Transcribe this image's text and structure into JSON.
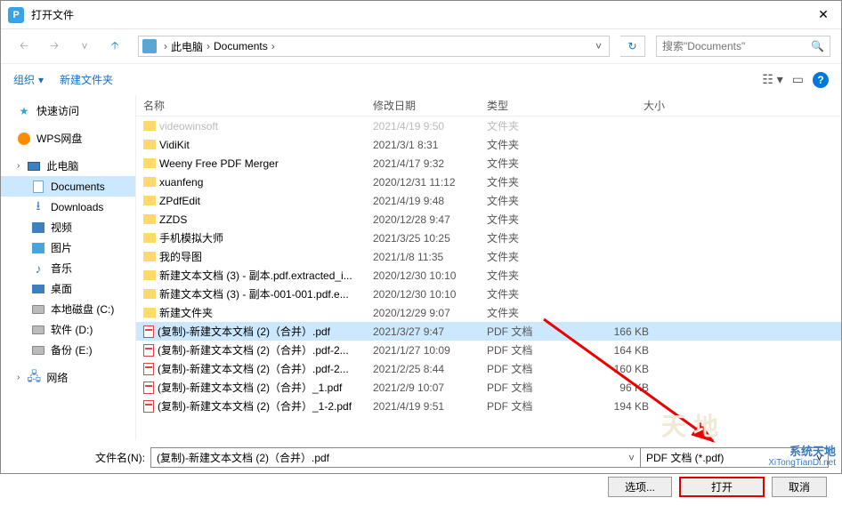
{
  "window": {
    "title": "打开文件"
  },
  "breadcrumb": {
    "root": "此电脑",
    "folder": "Documents"
  },
  "search": {
    "placeholder": "搜索\"Documents\""
  },
  "toolbar": {
    "organize": "组织",
    "newfolder": "新建文件夹"
  },
  "columns": {
    "name": "名称",
    "date": "修改日期",
    "type": "类型",
    "size": "大小"
  },
  "sidebar": [
    {
      "label": "快速访问",
      "icon": "star"
    },
    {
      "label": "WPS网盘",
      "icon": "wps"
    },
    {
      "label": "此电脑",
      "icon": "pc",
      "chev": true
    },
    {
      "label": "Documents",
      "icon": "doc",
      "indent": true,
      "selected": true
    },
    {
      "label": "Downloads",
      "icon": "down",
      "indent": true
    },
    {
      "label": "视频",
      "icon": "video",
      "indent": true
    },
    {
      "label": "图片",
      "icon": "img",
      "indent": true
    },
    {
      "label": "音乐",
      "icon": "music",
      "indent": true
    },
    {
      "label": "桌面",
      "icon": "desk",
      "indent": true
    },
    {
      "label": "本地磁盘 (C:)",
      "icon": "drive",
      "indent": true
    },
    {
      "label": "软件 (D:)",
      "icon": "drive",
      "indent": true
    },
    {
      "label": "备份 (E:)",
      "icon": "drive",
      "indent": true
    },
    {
      "label": "网络",
      "icon": "net",
      "chev": true
    }
  ],
  "files": [
    {
      "name": "videowinsoft",
      "date": "2021/4/19 9:50",
      "type": "文件夹",
      "icon": "folder",
      "dim": true
    },
    {
      "name": "VidiKit",
      "date": "2021/3/1 8:31",
      "type": "文件夹",
      "icon": "folder"
    },
    {
      "name": "Weeny Free PDF Merger",
      "date": "2021/4/17 9:32",
      "type": "文件夹",
      "icon": "folder"
    },
    {
      "name": "xuanfeng",
      "date": "2020/12/31 11:12",
      "type": "文件夹",
      "icon": "folder"
    },
    {
      "name": "ZPdfEdit",
      "date": "2021/4/19 9:48",
      "type": "文件夹",
      "icon": "folder"
    },
    {
      "name": "ZZDS",
      "date": "2020/12/28 9:47",
      "type": "文件夹",
      "icon": "folder"
    },
    {
      "name": "手机模拟大师",
      "date": "2021/3/25 10:25",
      "type": "文件夹",
      "icon": "folder"
    },
    {
      "name": "我的导图",
      "date": "2021/1/8 11:35",
      "type": "文件夹",
      "icon": "folder"
    },
    {
      "name": "新建文本文档 (3) - 副本.pdf.extracted_i...",
      "date": "2020/12/30 10:10",
      "type": "文件夹",
      "icon": "folder"
    },
    {
      "name": "新建文本文档 (3) - 副本-001-001.pdf.e...",
      "date": "2020/12/30 10:10",
      "type": "文件夹",
      "icon": "folder"
    },
    {
      "name": "新建文件夹",
      "date": "2020/12/29 9:07",
      "type": "文件夹",
      "icon": "folder"
    },
    {
      "name": "(复制)-新建文本文档 (2)（合并）.pdf",
      "date": "2021/3/27 9:47",
      "type": "PDF 文档",
      "size": "166 KB",
      "icon": "pdf",
      "selected": true
    },
    {
      "name": "(复制)-新建文本文档 (2)（合并）.pdf-2...",
      "date": "2021/1/27 10:09",
      "type": "PDF 文档",
      "size": "164 KB",
      "icon": "pdf"
    },
    {
      "name": "(复制)-新建文本文档 (2)（合并）.pdf-2...",
      "date": "2021/2/25 8:44",
      "type": "PDF 文档",
      "size": "160 KB",
      "icon": "pdf"
    },
    {
      "name": "(复制)-新建文本文档 (2)（合并）_1.pdf",
      "date": "2021/2/9 10:07",
      "type": "PDF 文档",
      "size": "96 KB",
      "icon": "pdf"
    },
    {
      "name": "(复制)-新建文本文档 (2)（合并）_1-2.pdf",
      "date": "2021/4/19 9:51",
      "type": "PDF 文档",
      "size": "194 KB",
      "icon": "pdf"
    }
  ],
  "bottom": {
    "fname_label": "文件名(N):",
    "fname_value": "(复制)-新建文本文档 (2)（合并）.pdf",
    "filter": "PDF 文档 (*.pdf)",
    "options": "选项...",
    "open": "打开",
    "cancel": "取消"
  },
  "watermark": {
    "line1": "系统天地",
    "line2": "XiTongTianDi.net"
  }
}
